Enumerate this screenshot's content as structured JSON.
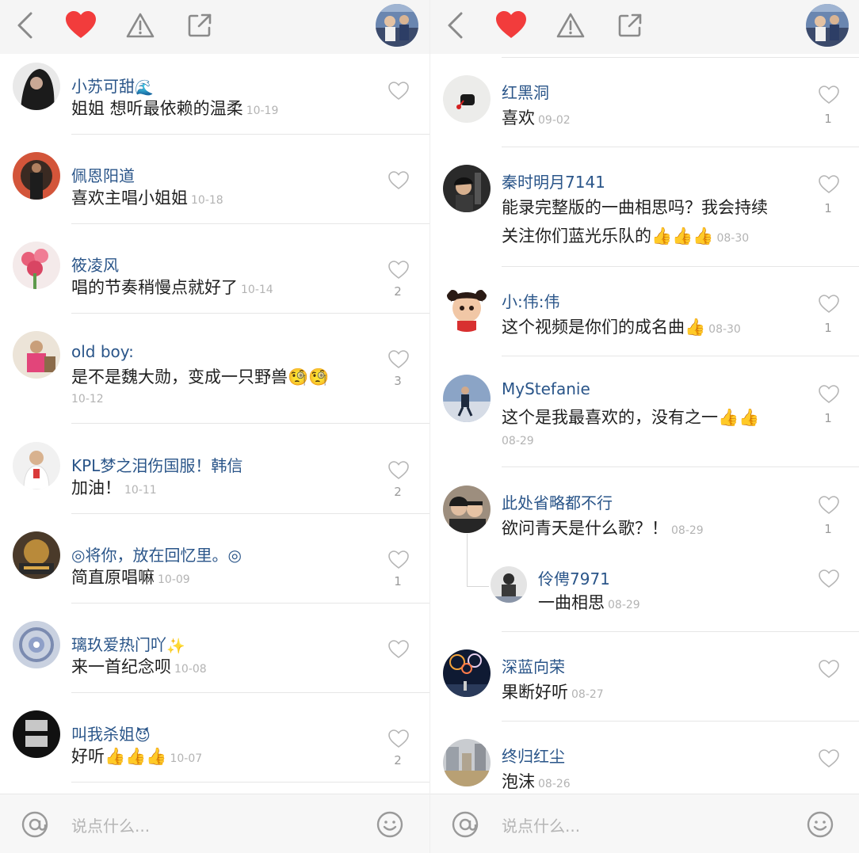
{
  "icons": {
    "back": "chevron-left-icon",
    "favorite": "heart-icon",
    "report": "warning-icon",
    "share": "share-icon",
    "like": "heart-outline-icon",
    "mention": "at-icon",
    "emoji": "smile-icon"
  },
  "colors": {
    "accent_heart": "#f23c3c",
    "username": "#2a5589",
    "time": "#b3b3b3"
  },
  "left": {
    "input_placeholder": "说点什么...",
    "comments": [
      {
        "name": "小苏可甜",
        "name_suffix": "🌊",
        "text": "姐姐 想听最依赖的温柔",
        "time": "10-19",
        "likes": ""
      },
      {
        "name": "佩恩阳道",
        "name_suffix": "",
        "text": "喜欢主唱小姐姐",
        "time": "10-18",
        "likes": ""
      },
      {
        "name": "筱凌风",
        "name_suffix": "",
        "text": "唱的节奏稍慢点就好了",
        "time": "10-14",
        "likes": "2"
      },
      {
        "name": "old boy:",
        "name_suffix": "",
        "text": "是不是魏大勋，变成一只野兽🧐🧐",
        "time": "10-12",
        "likes": "3"
      },
      {
        "name": "KPL梦之泪伤国服！韩信",
        "name_suffix": "",
        "text": "加油！",
        "time": "10-11",
        "likes": "2"
      },
      {
        "name": "◎将你，放在回忆里。◎",
        "name_suffix": "",
        "text": "简直原唱嘛",
        "time": "10-09",
        "likes": "1"
      },
      {
        "name": "璃玖爱热门吖",
        "name_suffix": "✨",
        "text": "来一首纪念呗",
        "time": "10-08",
        "likes": ""
      },
      {
        "name": "叫我杀姐",
        "name_suffix": "😈",
        "text": "好听👍👍👍",
        "time": "10-07",
        "likes": "2"
      }
    ]
  },
  "right": {
    "input_placeholder": "说点什么...",
    "comments": [
      {
        "name": "红黑洞",
        "text": "喜欢",
        "time": "09-02",
        "likes": "1"
      },
      {
        "name": "秦时明月7141",
        "text": "能录完整版的一曲相思吗？我会持续",
        "text2": "关注你们蓝光乐队的👍👍👍",
        "time": "08-30",
        "likes": "1"
      },
      {
        "name": "小:伟:伟",
        "text": "这个视频是你们的成名曲👍",
        "time": "08-30",
        "likes": "1"
      },
      {
        "name": "MyStefanie",
        "text": "这个是我最喜欢的，没有之一👍👍",
        "time": "08-29",
        "likes": "1"
      },
      {
        "name": "此处省略都不行",
        "text": "欲问青天是什么歌？！",
        "time": "08-29",
        "likes": "1"
      },
      {
        "name": "伶俜7971",
        "text": "一曲相思",
        "time": "08-29",
        "likes": ""
      },
      {
        "name": "深蓝向荣",
        "text": "果断好听",
        "time": "08-27",
        "likes": ""
      },
      {
        "name": "终归红尘",
        "text": "泡沫",
        "time": "08-26",
        "likes": ""
      }
    ]
  }
}
